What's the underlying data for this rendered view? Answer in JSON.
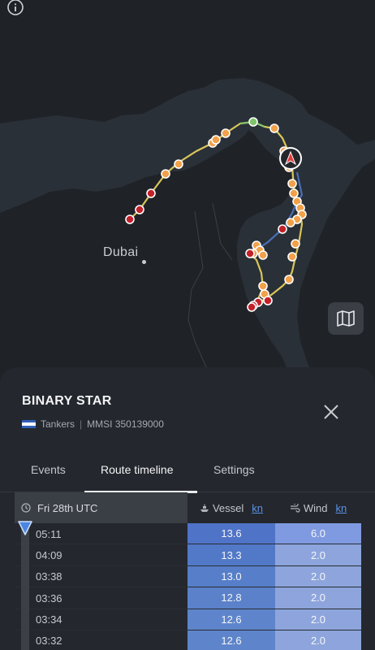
{
  "map": {
    "city_label": "Dubai",
    "colors": {
      "sea": "#2a3037",
      "land": "#1f2227",
      "track_green": "#7fc36a",
      "track_yellow": "#d9c65a",
      "track_blue": "#4a6fb5",
      "point_orange": "#f2a14a",
      "point_red": "#c4202a"
    },
    "icons": [
      "info-icon",
      "vessel-arrow-icon",
      "map-layers-icon"
    ]
  },
  "vessel": {
    "name": "BINARY STAR",
    "type": "Tankers",
    "mmsi_label": "MMSI 350139000",
    "separator": "|"
  },
  "tabs": [
    {
      "label": "Events",
      "active": false
    },
    {
      "label": "Route timeline",
      "active": true
    },
    {
      "label": "Settings",
      "active": false
    }
  ],
  "table": {
    "date_header": "Fri 28th UTC",
    "vessel_header": "Vessel",
    "wind_header": "Wind",
    "vessel_unit": "kn",
    "wind_unit": "kn",
    "rows": [
      {
        "time": "05:11",
        "vessel": "13.6",
        "wind": "6.0",
        "vessel_color": "#4f73c7",
        "wind_color": "#7f9ae0"
      },
      {
        "time": "04:09",
        "vessel": "13.3",
        "wind": "2.0",
        "vessel_color": "#5279c8",
        "wind_color": "#8da5dc"
      },
      {
        "time": "03:38",
        "vessel": "13.0",
        "wind": "2.0",
        "vessel_color": "#567ec9",
        "wind_color": "#8da5dc"
      },
      {
        "time": "03:36",
        "vessel": "12.8",
        "wind": "2.0",
        "vessel_color": "#5a81ca",
        "wind_color": "#8da5dc"
      },
      {
        "time": "03:34",
        "vessel": "12.6",
        "wind": "2.0",
        "vessel_color": "#5e85cb",
        "wind_color": "#8da5dc"
      },
      {
        "time": "03:32",
        "vessel": "12.6",
        "wind": "2.0",
        "vessel_color": "#5e85cb",
        "wind_color": "#8da5dc"
      }
    ]
  }
}
